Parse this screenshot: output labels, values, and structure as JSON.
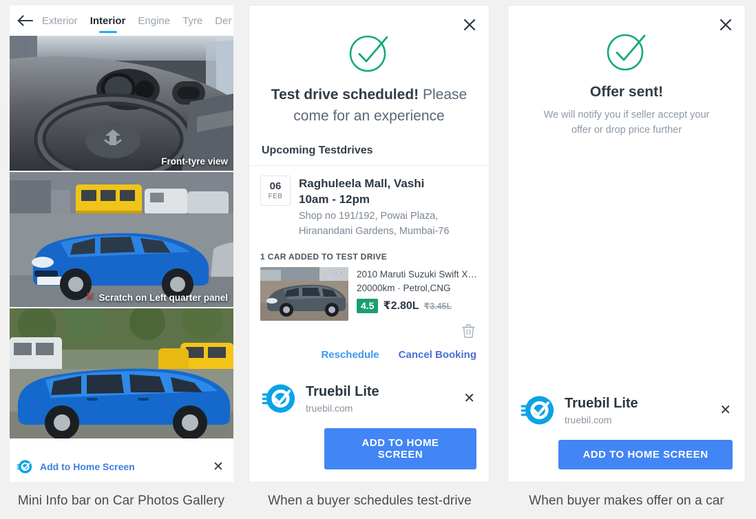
{
  "theme": {
    "accent_blue": "#4285f4",
    "link_blue": "#3b97ef",
    "link_dark_blue": "#4a6fd6",
    "success_green": "#12a97a",
    "rating_green": "#1b9e6e",
    "logo_blue": "#0aa3e8",
    "page_bg": "#f1f1f1"
  },
  "panel1": {
    "caption": "Mini Info bar on Car Photos Gallery",
    "back_icon": "arrow-left-icon",
    "tabs": [
      {
        "label": "Exterior",
        "active": false
      },
      {
        "label": "Interior",
        "active": true
      },
      {
        "label": "Engine",
        "active": false
      },
      {
        "label": "Tyre",
        "active": false
      },
      {
        "label": "Der",
        "active": false
      }
    ],
    "photos": [
      {
        "label": "Front-tyre view",
        "defect": false
      },
      {
        "label": "Scratch on Left quarter panel",
        "defect": true,
        "defect_icon": "x-mark-icon"
      },
      {
        "label": "",
        "defect": false
      }
    ],
    "mini_bar": {
      "logo_icon": "truebil-logo-icon",
      "label": "Add to Home Screen",
      "close_icon": "close-icon"
    }
  },
  "panel2": {
    "caption": "When a buyer schedules test-drive",
    "close_icon": "close-icon",
    "success_icon": "check-circle-icon",
    "headline_bold": "Test drive scheduled!",
    "headline_rest": " Please come for an experience",
    "section_title": "Upcoming Testdrives",
    "testdrive": {
      "date_day": "06",
      "date_month": "FEB",
      "place": "Raghuleela Mall, Vashi",
      "time": "10am - 12pm",
      "address": "Shop no 191/192, Powai Plaza, Hiranandani Gardens, Mumbai-76"
    },
    "cars_label": "1 CAR ADDED TO TEST DRIVE",
    "car": {
      "favourite_icon": "heart-icon",
      "title": "2010 Maruti Suzuki Swift XLI...",
      "specs": "20000km · Petrol,CNG",
      "rating": "4.5",
      "price": "₹2.80L",
      "price_old": "₹3.45L",
      "delete_icon": "trash-icon"
    },
    "actions": [
      {
        "label": "Reschedule",
        "style": "blue"
      },
      {
        "label": "Cancel Booking",
        "style": "darkblue"
      }
    ],
    "install": {
      "logo_icon": "truebil-logo-icon",
      "title": "Truebil Lite",
      "url": "truebil.com",
      "close_icon": "close-icon",
      "button": "ADD TO HOME SCREEN"
    }
  },
  "panel3": {
    "caption": "When buyer makes offer on a car",
    "close_icon": "close-icon",
    "success_icon": "check-circle-icon",
    "headline": "Offer sent!",
    "subtext": "We will notify you if seller accept your offer or drop price further",
    "install": {
      "logo_icon": "truebil-logo-icon",
      "title": "Truebil Lite",
      "url": "truebil.com",
      "close_icon": "close-icon",
      "button": "ADD TO HOME SCREEN"
    }
  }
}
